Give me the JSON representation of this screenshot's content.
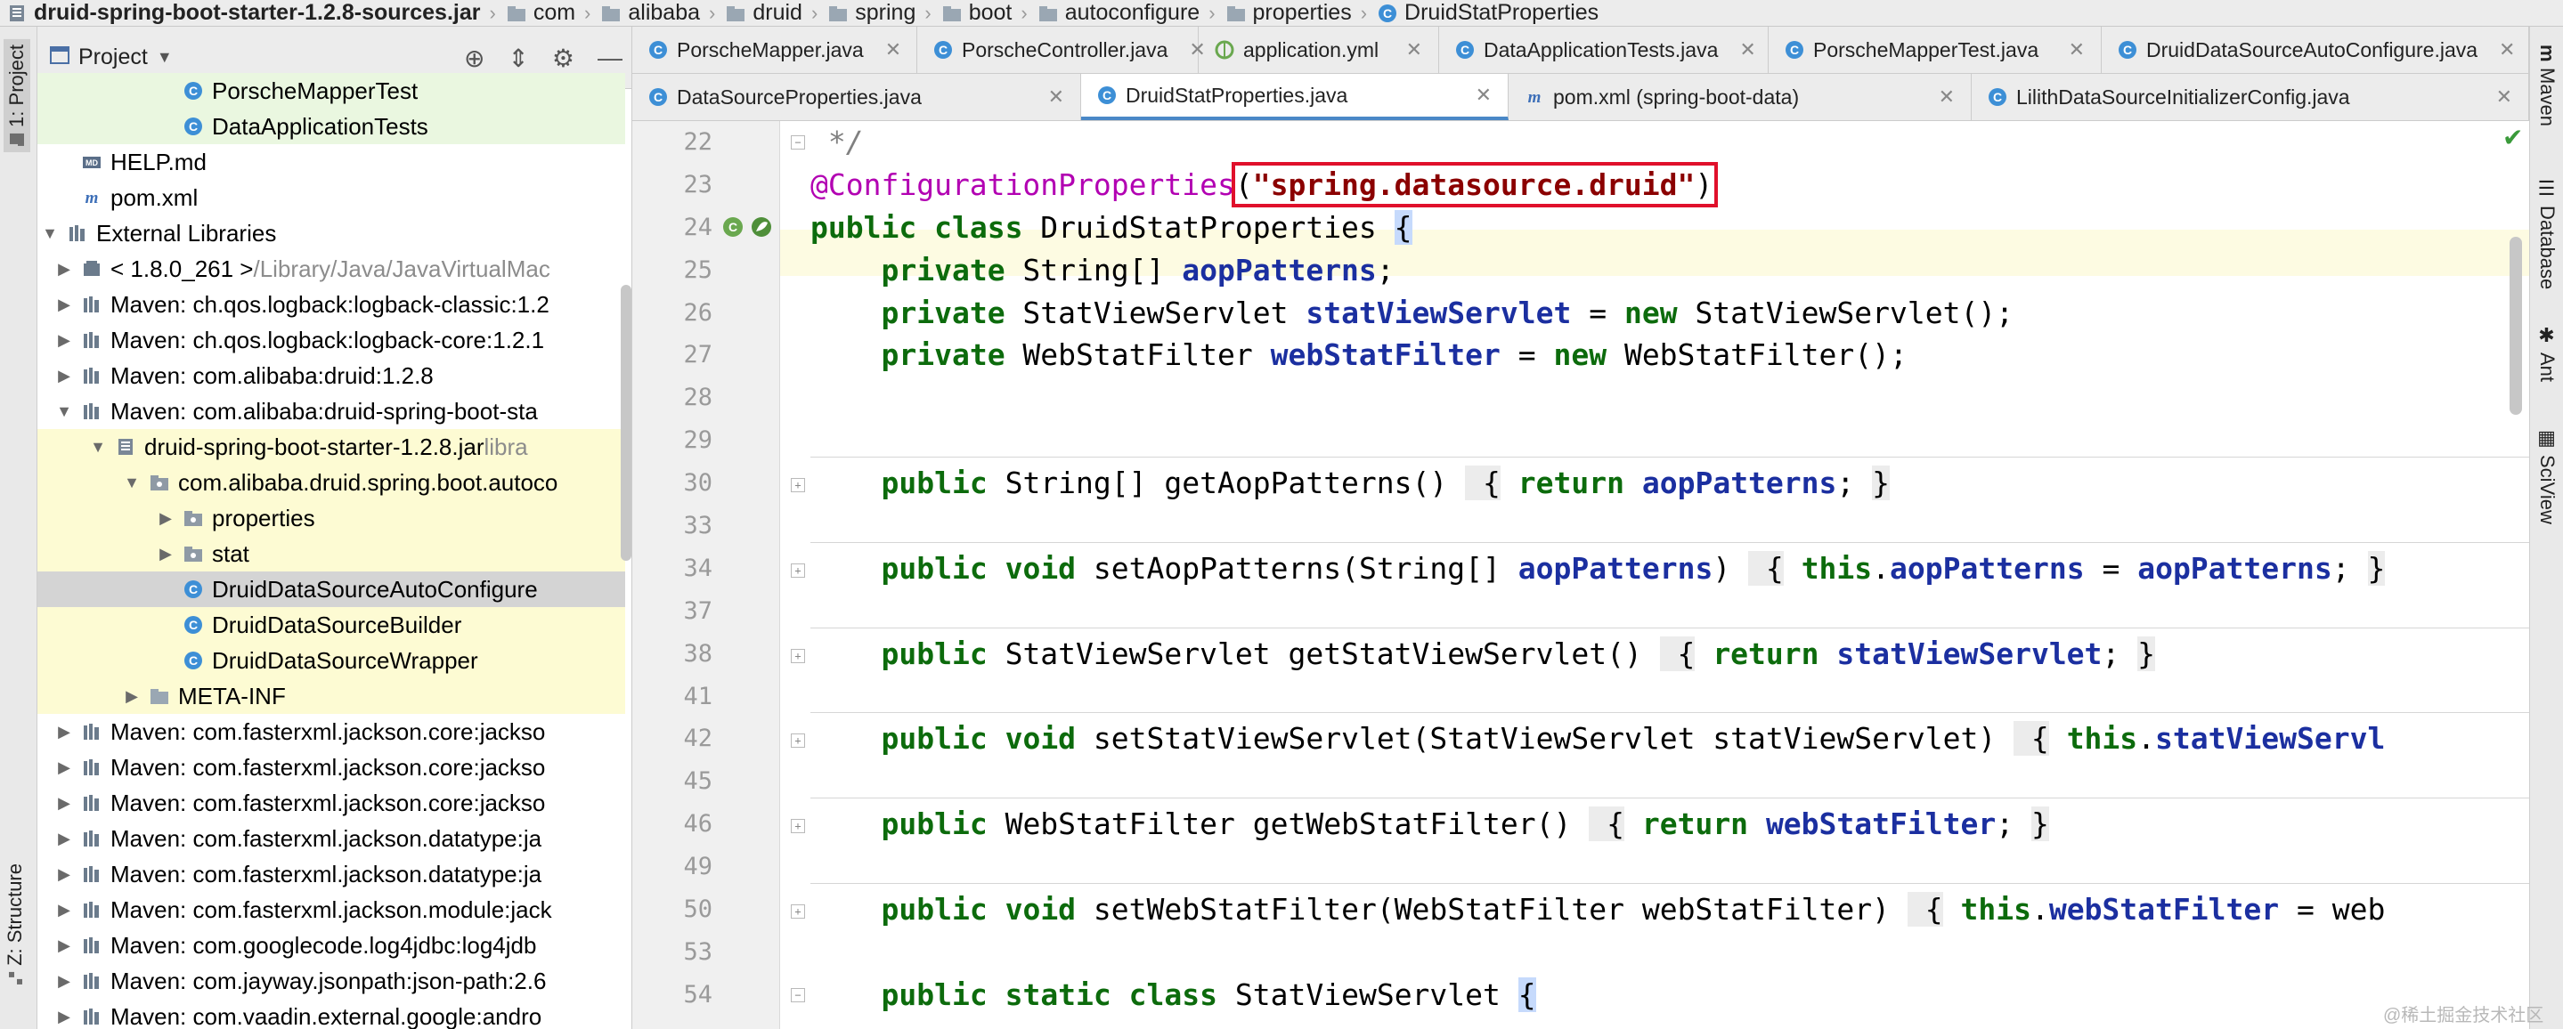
{
  "breadcrumb": [
    {
      "label": "druid-spring-boot-starter-1.2.8-sources.jar",
      "icon": "jar-icon"
    },
    {
      "label": "com",
      "icon": "folder-icon"
    },
    {
      "label": "alibaba",
      "icon": "folder-icon"
    },
    {
      "label": "druid",
      "icon": "folder-icon"
    },
    {
      "label": "spring",
      "icon": "folder-icon"
    },
    {
      "label": "boot",
      "icon": "folder-icon"
    },
    {
      "label": "autoconfigure",
      "icon": "folder-icon"
    },
    {
      "label": "properties",
      "icon": "folder-icon"
    },
    {
      "label": "DruidStatProperties",
      "icon": "class-icon"
    }
  ],
  "left_strip": {
    "project_tab": "1: Project",
    "structure_tab": "Z: Structure"
  },
  "right_strip": {
    "maven_tab": "Maven",
    "database_tab": "Database",
    "ant_tab": "Ant",
    "sciview_tab": "SciView"
  },
  "project_panel": {
    "title": "Project",
    "tree": [
      {
        "label": "PorscheMapperTest",
        "indent": 3,
        "icon": "class-icon",
        "style": "green",
        "arrow": ""
      },
      {
        "label": "DataApplicationTests",
        "indent": 3,
        "icon": "class-icon",
        "style": "green",
        "arrow": ""
      },
      {
        "label": "HELP.md",
        "indent": 0,
        "icon": "markdown-icon",
        "style": "",
        "arrow": ""
      },
      {
        "label": "pom.xml",
        "indent": 0,
        "icon": "maven-icon",
        "style": "",
        "arrow": ""
      },
      {
        "label": "External Libraries",
        "indent": -1,
        "icon": "library-icon",
        "style": "",
        "arrow": "down"
      },
      {
        "label": "< 1.8.0_261 >",
        "suffix": " /Library/Java/JavaVirtualMac",
        "indent": 0,
        "icon": "jdk-icon",
        "style": "",
        "arrow": "right"
      },
      {
        "label": "Maven: ch.qos.logback:logback-classic:1.2",
        "indent": 0,
        "icon": "library-icon",
        "style": "",
        "arrow": "right"
      },
      {
        "label": "Maven: ch.qos.logback:logback-core:1.2.1",
        "indent": 0,
        "icon": "library-icon",
        "style": "",
        "arrow": "right"
      },
      {
        "label": "Maven: com.alibaba:druid:1.2.8",
        "indent": 0,
        "icon": "library-icon",
        "style": "",
        "arrow": "right"
      },
      {
        "label": "Maven: com.alibaba:druid-spring-boot-sta",
        "indent": 0,
        "icon": "library-icon",
        "style": "",
        "arrow": "down"
      },
      {
        "label": "druid-spring-boot-starter-1.2.8.jar",
        "suffix": " libra",
        "indent": 1,
        "icon": "jar-icon",
        "style": "hl",
        "arrow": "down"
      },
      {
        "label": "com.alibaba.druid.spring.boot.autoco",
        "indent": 2,
        "icon": "package-icon",
        "style": "hl",
        "arrow": "down"
      },
      {
        "label": "properties",
        "indent": 3,
        "icon": "package-icon",
        "style": "hl",
        "arrow": "right"
      },
      {
        "label": "stat",
        "indent": 3,
        "icon": "package-icon",
        "style": "hl",
        "arrow": "right"
      },
      {
        "label": "DruidDataSourceAutoConfigure",
        "indent": 3,
        "icon": "class-icon",
        "style": "sel",
        "arrow": ""
      },
      {
        "label": "DruidDataSourceBuilder",
        "indent": 3,
        "icon": "class-icon",
        "style": "hl",
        "arrow": ""
      },
      {
        "label": "DruidDataSourceWrapper",
        "indent": 3,
        "icon": "class-icon",
        "style": "hl",
        "arrow": ""
      },
      {
        "label": "META-INF",
        "indent": 2,
        "icon": "folder-icon",
        "style": "hl",
        "arrow": "right"
      },
      {
        "label": "Maven: com.fasterxml.jackson.core:jackso",
        "indent": 0,
        "icon": "library-icon",
        "style": "",
        "arrow": "right"
      },
      {
        "label": "Maven: com.fasterxml.jackson.core:jackso",
        "indent": 0,
        "icon": "library-icon",
        "style": "",
        "arrow": "right"
      },
      {
        "label": "Maven: com.fasterxml.jackson.core:jackso",
        "indent": 0,
        "icon": "library-icon",
        "style": "",
        "arrow": "right"
      },
      {
        "label": "Maven: com.fasterxml.jackson.datatype:ja",
        "indent": 0,
        "icon": "library-icon",
        "style": "",
        "arrow": "right"
      },
      {
        "label": "Maven: com.fasterxml.jackson.datatype:ja",
        "indent": 0,
        "icon": "library-icon",
        "style": "",
        "arrow": "right"
      },
      {
        "label": "Maven: com.fasterxml.jackson.module:jack",
        "indent": 0,
        "icon": "library-icon",
        "style": "",
        "arrow": "right"
      },
      {
        "label": "Maven: com.googlecode.log4jdbc:log4jdb",
        "indent": 0,
        "icon": "library-icon",
        "style": "",
        "arrow": "right"
      },
      {
        "label": "Maven: com.jayway.jsonpath:json-path:2.6",
        "indent": 0,
        "icon": "library-icon",
        "style": "",
        "arrow": "right"
      },
      {
        "label": "Maven: com.vaadin.external.google:andro",
        "indent": 0,
        "icon": "library-icon",
        "style": "",
        "arrow": "right"
      }
    ]
  },
  "tabs_row1": [
    {
      "label": "PorscheMapper.java",
      "icon": "class-icon"
    },
    {
      "label": "PorscheController.java",
      "icon": "class-icon"
    },
    {
      "label": "application.yml",
      "icon": "yml-icon"
    },
    {
      "label": "DataApplicationTests.java",
      "icon": "class-icon"
    },
    {
      "label": "PorscheMapperTest.java",
      "icon": "class-icon"
    },
    {
      "label": "DruidDataSourceAutoConfigure.java",
      "icon": "class-icon"
    }
  ],
  "tabs_row2": [
    {
      "label": "DataSourceProperties.java",
      "icon": "class-icon",
      "active": false
    },
    {
      "label": "DruidStatProperties.java",
      "icon": "class-icon",
      "active": true
    },
    {
      "label": "pom.xml (spring-boot-data)",
      "icon": "maven-icon",
      "active": false
    },
    {
      "label": "LilithDataSourceInitializerConfig.java",
      "icon": "class-icon",
      "active": false
    }
  ],
  "code": [
    {
      "line": "22",
      "text": " */"
    },
    {
      "line": "23",
      "text": "@ConfigurationProperties(\"spring.datasource.druid\")"
    },
    {
      "line": "24",
      "text": "public class DruidStatProperties {"
    },
    {
      "line": "25",
      "text": "    private String[] aopPatterns;"
    },
    {
      "line": "26",
      "text": "    private StatViewServlet statViewServlet = new StatViewServlet();"
    },
    {
      "line": "27",
      "text": "    private WebStatFilter webStatFilter = new WebStatFilter();"
    },
    {
      "line": "28",
      "text": ""
    },
    {
      "line": "29",
      "text": ""
    },
    {
      "line": "30",
      "text": "    public String[] getAopPatterns() { return aopPatterns; }"
    },
    {
      "line": "33",
      "text": ""
    },
    {
      "line": "34",
      "text": "    public void setAopPatterns(String[] aopPatterns) { this.aopPatterns = aopPatterns; }"
    },
    {
      "line": "37",
      "text": ""
    },
    {
      "line": "38",
      "text": "    public StatViewServlet getStatViewServlet() { return statViewServlet; }"
    },
    {
      "line": "41",
      "text": ""
    },
    {
      "line": "42",
      "text": "    public void setStatViewServlet(StatViewServlet statViewServlet) { this.statViewServl"
    },
    {
      "line": "45",
      "text": ""
    },
    {
      "line": "46",
      "text": "    public WebStatFilter getWebStatFilter() { return webStatFilter; }"
    },
    {
      "line": "49",
      "text": ""
    },
    {
      "line": "50",
      "text": "    public void setWebStatFilter(WebStatFilter webStatFilter) { this.webStatFilter = web"
    },
    {
      "line": "53",
      "text": ""
    },
    {
      "line": "54",
      "text": "    public static class StatViewServlet {"
    }
  ],
  "highlight_annotation": "(\"spring.datasource.druid\")",
  "watermark": "@稀土掘金技术社区",
  "colors": {
    "accent": "#4a88c7",
    "highlight_box": "#e0102b",
    "keyword": "#000080",
    "field": "#1b2fa0",
    "annotation": "#b200b2"
  }
}
